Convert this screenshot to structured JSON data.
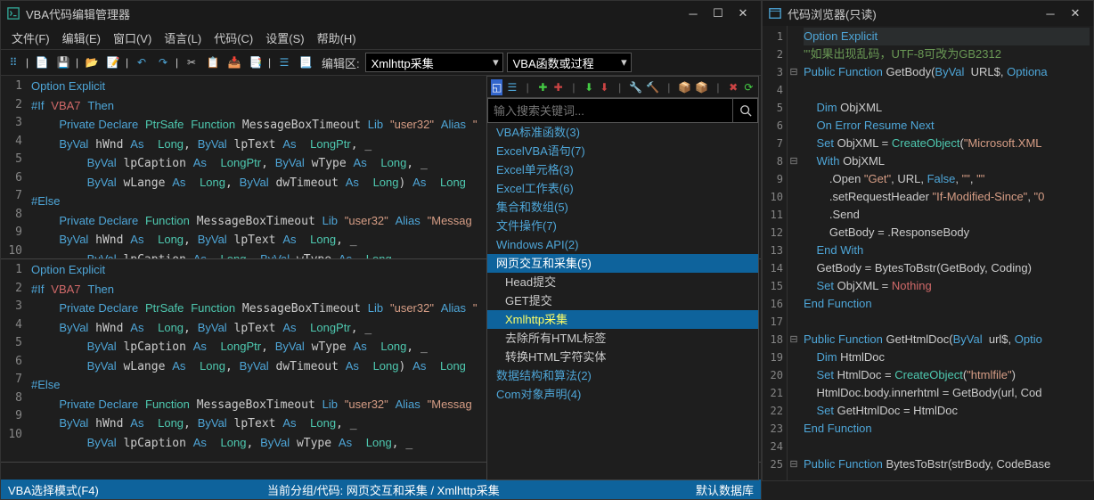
{
  "leftWindow": {
    "title": "VBA代码编辑管理器",
    "menu": [
      "文件(F)",
      "编辑(E)",
      "窗口(V)",
      "语言(L)",
      "代码(C)",
      "设置(S)",
      "帮助(H)"
    ],
    "toolbarLabel": "编辑区:",
    "dropdown1": "Xmlhttp采集",
    "dropdown2": "VBA函数或过程",
    "status": {
      "left": "VBA选择模式(F4)",
      "mid": "当前分组/代码:  网页交互和采集  /  Xmlhttp采集",
      "right": "默认数据库"
    }
  },
  "code1": {
    "lines": [
      {
        "n": "1",
        "html": "<span class='kw'>Option Explicit</span>"
      },
      {
        "n": "2",
        "html": "<span class='kw'>#If</span> <span class='vba7'>VBA7</span> <span class='kw'>Then</span>"
      },
      {
        "n": "3",
        "html": "    <span class='kw'>Private Declare</span> <span class='ty'>PtrSafe</span> <span class='fn'>Function</span> MessageBoxTimeout <span class='kw'>Lib</span> <span class='str2'>\"user32\"</span> <span class='kw'>Alias</span> <span class='str2'>\"</span>"
      },
      {
        "n": "4",
        "html": "    <span class='kw'>ByVal</span> hWnd <span class='kw'>As</span>  <span class='ty'>Long</span>, <span class='kw'>ByVal</span> lpText <span class='kw'>As</span>  <span class='ty'>LongPtr</span>, _"
      },
      {
        "n": "5",
        "html": "        <span class='kw'>ByVal</span> lpCaption <span class='kw'>As</span>  <span class='ty'>LongPtr</span>, <span class='kw'>ByVal</span> wType <span class='kw'>As</span>  <span class='ty'>Long</span>, _"
      },
      {
        "n": "6",
        "html": "        <span class='kw'>ByVal</span> wLange <span class='kw'>As</span>  <span class='ty'>Long</span>, <span class='kw'>ByVal</span> dwTimeout <span class='kw'>As</span>  <span class='ty'>Long</span>) <span class='kw'>As</span>  <span class='ty'>Long</span>"
      },
      {
        "n": "7",
        "html": "<span class='kw'>#Else</span>"
      },
      {
        "n": "8",
        "html": "    <span class='kw'>Private Declare</span> <span class='fn'>Function</span> MessageBoxTimeout <span class='kw'>Lib</span> <span class='str2'>\"user32\"</span> <span class='kw'>Alias</span> <span class='str2'>\"Messag</span>"
      },
      {
        "n": "9",
        "html": "    <span class='kw'>ByVal</span> hWnd <span class='kw'>As</span>  <span class='ty'>Long</span>, <span class='kw'>ByVal</span> lpText <span class='kw'>As</span>  <span class='ty'>Long</span>, _"
      },
      {
        "n": "10",
        "html": "        <span class='kw'>ByVal</span> lpCaption <span class='kw'>As</span>  <span class='ty'>Long</span>, <span class='kw'>ByVal</span> wType <span class='kw'>As</span>  <span class='ty'>Long</span>, _"
      }
    ]
  },
  "code2": {
    "lines": [
      {
        "n": "1",
        "html": "<span class='kw'>Option Explicit</span>"
      },
      {
        "n": "2",
        "html": "<span class='kw'>#If</span> <span class='vba7'>VBA7</span> <span class='kw'>Then</span>"
      },
      {
        "n": "3",
        "html": "    <span class='kw'>Private Declare</span> <span class='ty'>PtrSafe</span> <span class='fn'>Function</span> MessageBoxTimeout <span class='kw'>Lib</span> <span class='str2'>\"user32\"</span> <span class='kw'>Alias</span> <span class='str2'>\"</span>"
      },
      {
        "n": "4",
        "html": "    <span class='kw'>ByVal</span> hWnd <span class='kw'>As</span>  <span class='ty'>Long</span>, <span class='kw'>ByVal</span> lpText <span class='kw'>As</span>  <span class='ty'>LongPtr</span>, _"
      },
      {
        "n": "5",
        "html": "        <span class='kw'>ByVal</span> lpCaption <span class='kw'>As</span>  <span class='ty'>LongPtr</span>, <span class='kw'>ByVal</span> wType <span class='kw'>As</span>  <span class='ty'>Long</span>, _"
      },
      {
        "n": "6",
        "html": "        <span class='kw'>ByVal</span> wLange <span class='kw'>As</span>  <span class='ty'>Long</span>, <span class='kw'>ByVal</span> dwTimeout <span class='kw'>As</span>  <span class='ty'>Long</span>) <span class='kw'>As</span>  <span class='ty'>Long</span>"
      },
      {
        "n": "7",
        "html": "<span class='kw'>#Else</span>"
      },
      {
        "n": "8",
        "html": "    <span class='kw'>Private Declare</span> <span class='fn'>Function</span> MessageBoxTimeout <span class='kw'>Lib</span> <span class='str2'>\"user32\"</span> <span class='kw'>Alias</span> <span class='str2'>\"Messag</span>"
      },
      {
        "n": "9",
        "html": "    <span class='kw'>ByVal</span> hWnd <span class='kw'>As</span>  <span class='ty'>Long</span>, <span class='kw'>ByVal</span> lpText <span class='kw'>As</span>  <span class='ty'>Long</span>, _"
      },
      {
        "n": "10",
        "html": "        <span class='kw'>ByVal</span> lpCaption <span class='kw'>As</span>  <span class='ty'>Long</span>, <span class='kw'>ByVal</span> wType <span class='kw'>As</span>  <span class='ty'>Long</span>, _"
      }
    ]
  },
  "tree": {
    "searchPlaceholder": "输入搜索关键词...",
    "items": [
      {
        "label": "VBA标准函数(3)",
        "type": "group"
      },
      {
        "label": "ExcelVBA语句(7)",
        "type": "group"
      },
      {
        "label": "Excel单元格(3)",
        "type": "group"
      },
      {
        "label": "Excel工作表(6)",
        "type": "group"
      },
      {
        "label": "集合和数组(5)",
        "type": "group"
      },
      {
        "label": "文件操作(7)",
        "type": "group"
      },
      {
        "label": "Windows API(2)",
        "type": "group"
      },
      {
        "label": "网页交互和采集(5)",
        "type": "group",
        "sel": "parent"
      },
      {
        "label": "Head提交",
        "type": "child"
      },
      {
        "label": "GET提交",
        "type": "child"
      },
      {
        "label": "Xmlhttp采集",
        "type": "child",
        "sel": "item"
      },
      {
        "label": "去除所有HTML标签",
        "type": "child"
      },
      {
        "label": "转换HTML字符实体",
        "type": "child"
      },
      {
        "label": "数据结构和算法(2)",
        "type": "group"
      },
      {
        "label": "Com对象声明(4)",
        "type": "group"
      }
    ]
  },
  "rightWindow": {
    "title": "代码浏览器(只读)"
  },
  "rcode": {
    "lines": [
      {
        "n": "1",
        "fold": "",
        "html": "<span class='kw'>Option Explicit</span>",
        "cur": true
      },
      {
        "n": "2",
        "fold": "",
        "html": "<span class='cmt'>'''如果出现乱码，UTF-8可改为GB2312</span>"
      },
      {
        "n": "3",
        "fold": "⊟",
        "html": "<span class='kw'>Public Function</span> GetBody(<span class='kw'>ByVal</span>  URL$, <span class='kw'>Optiona</span>"
      },
      {
        "n": "4",
        "fold": "",
        "html": ""
      },
      {
        "n": "5",
        "fold": "",
        "html": "    <span class='kw'>Dim</span> ObjXML"
      },
      {
        "n": "6",
        "fold": "",
        "html": "    <span class='kw'>On Error Resume Next</span>"
      },
      {
        "n": "7",
        "fold": "",
        "html": "    <span class='kw'>Set</span> ObjXML = <span class='fn'>CreateObject</span>(<span class='str2'>\"Microsoft.XML</span>"
      },
      {
        "n": "8",
        "fold": "⊟",
        "html": "    <span class='kw'>With</span> ObjXML"
      },
      {
        "n": "9",
        "fold": "",
        "html": "        .Open <span class='str2'>\"Get\"</span>, URL, <span class='kw'>False</span>, <span class='str2'>\"\"</span>, <span class='str2'>\"\"</span>"
      },
      {
        "n": "10",
        "fold": "",
        "html": "        .setRequestHeader <span class='str2'>\"If-Modified-Since\"</span>, <span class='str2'>\"0</span>"
      },
      {
        "n": "11",
        "fold": "",
        "html": "        .Send"
      },
      {
        "n": "12",
        "fold": "",
        "html": "        GetBody = .ResponseBody"
      },
      {
        "n": "13",
        "fold": "",
        "html": "    <span class='kw'>End With</span>"
      },
      {
        "n": "14",
        "fold": "",
        "html": "    GetBody = BytesToBstr(GetBody, Coding)"
      },
      {
        "n": "15",
        "fold": "",
        "html": "    <span class='kw'>Set</span> ObjXML = <span class='noth'>Nothing</span>"
      },
      {
        "n": "16",
        "fold": "",
        "html": "<span class='kw'>End Function</span>"
      },
      {
        "n": "17",
        "fold": "",
        "html": ""
      },
      {
        "n": "18",
        "fold": "⊟",
        "html": "<span class='kw'>Public Function</span> GetHtmlDoc(<span class='kw'>ByVal</span>  url$, <span class='kw'>Optio</span>"
      },
      {
        "n": "19",
        "fold": "",
        "html": "    <span class='kw'>Dim</span> HtmlDoc"
      },
      {
        "n": "20",
        "fold": "",
        "html": "    <span class='kw'>Set</span> HtmlDoc = <span class='fn'>CreateObject</span>(<span class='str2'>\"htmlfile\"</span>)"
      },
      {
        "n": "21",
        "fold": "",
        "html": "    HtmlDoc.body.innerhtml = GetBody(url, Cod"
      },
      {
        "n": "22",
        "fold": "",
        "html": "    <span class='kw'>Set</span> GetHtmlDoc = HtmlDoc"
      },
      {
        "n": "23",
        "fold": "",
        "html": "<span class='kw'>End Function</span>"
      },
      {
        "n": "24",
        "fold": "",
        "html": ""
      },
      {
        "n": "25",
        "fold": "⊟",
        "html": "<span class='kw'>Public Function</span> BytesToBstr(strBody, CodeBase"
      }
    ]
  }
}
